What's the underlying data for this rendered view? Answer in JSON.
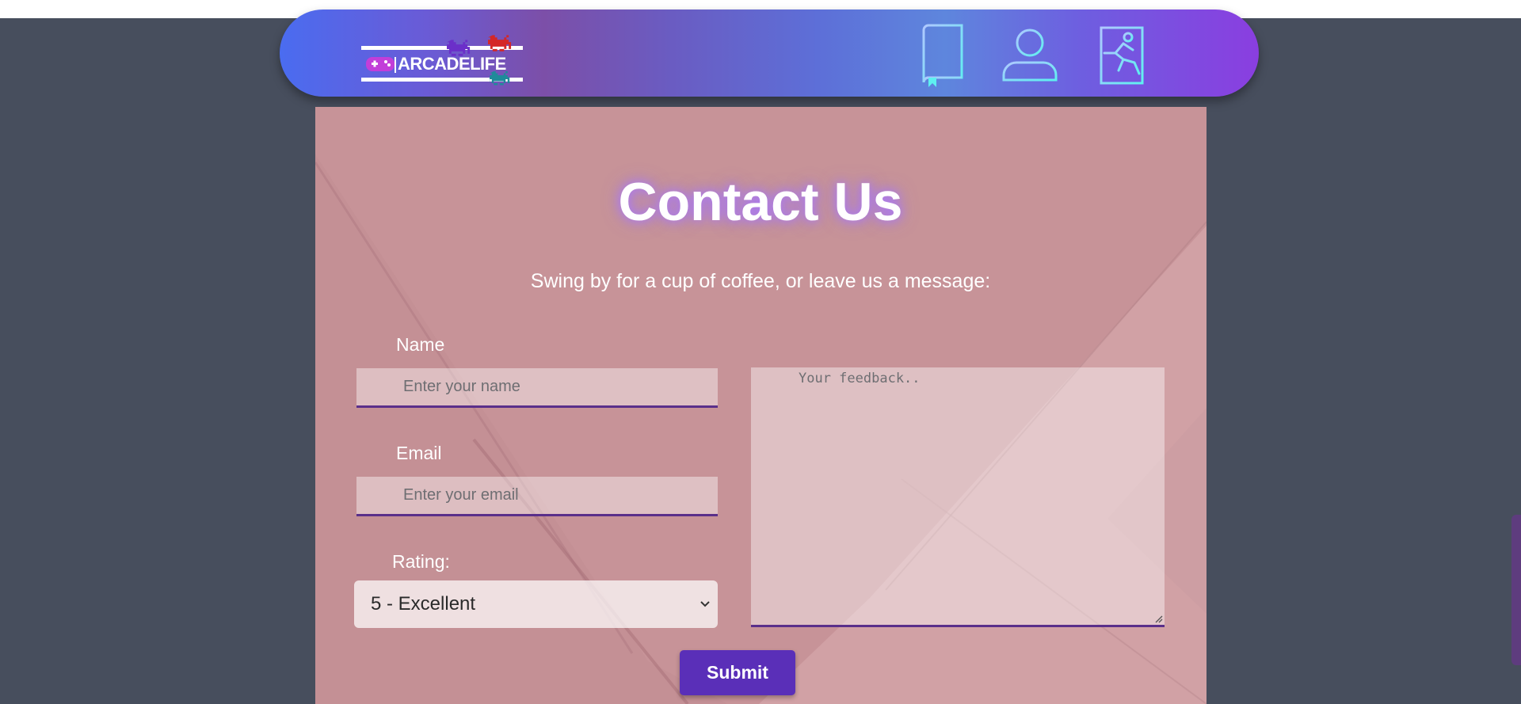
{
  "nav": {
    "logo_text": "ARCADELIFE",
    "icons": [
      "book-icon",
      "user-icon",
      "exit-icon"
    ]
  },
  "contact": {
    "title": "Contact Us",
    "subtitle": "Swing by for a cup of coffee, or leave us a message:"
  },
  "form": {
    "name_label": "Name",
    "name_placeholder": "Enter your name",
    "email_label": "Email",
    "email_placeholder": "Enter your email",
    "rating_label": "Rating:",
    "rating_selected": "5 - Excellent",
    "feedback_placeholder": "Your feedback..",
    "submit_label": "Submit"
  },
  "colors": {
    "page_bg": "#474e5d",
    "card_bg": "#c89398",
    "accent_purple": "#5a2fb8",
    "input_underline": "#5a2f8a"
  }
}
